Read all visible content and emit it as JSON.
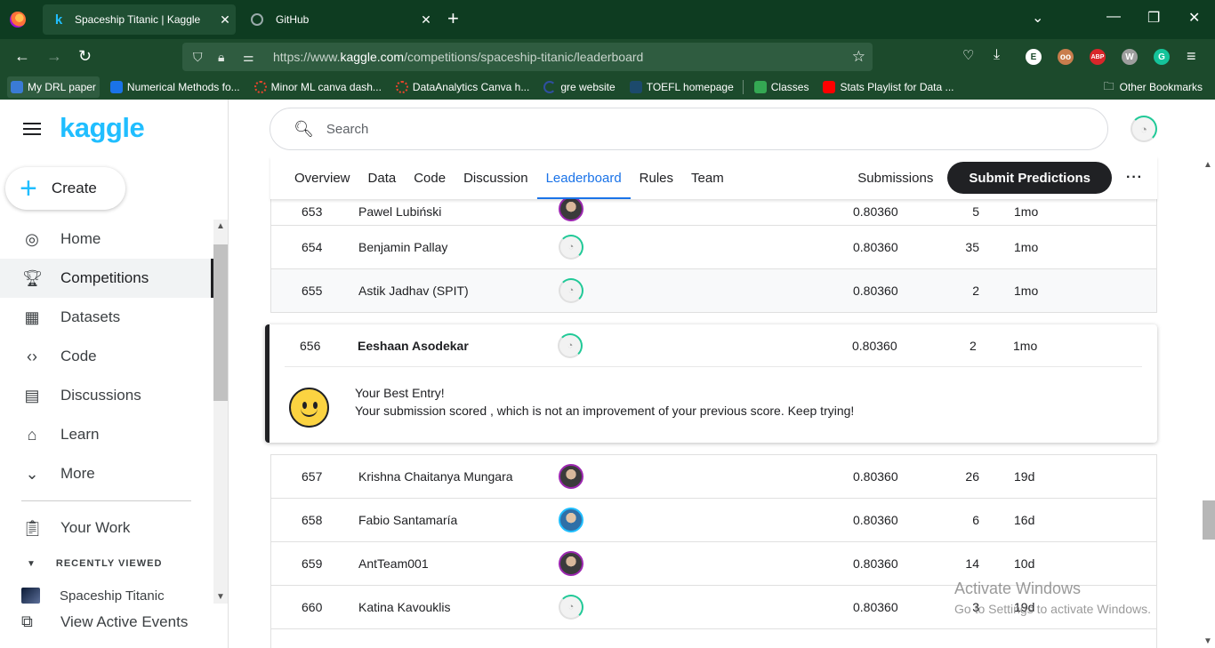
{
  "browser": {
    "tabs": [
      {
        "title": "Spaceship Titanic | Kaggle",
        "favicon": "k"
      },
      {
        "title": "GitHub"
      }
    ],
    "url_prefix": "https://www.",
    "url_domain": "kaggle.com",
    "url_path": "/competitions/spaceship-titanic/leaderboard",
    "bookmarks": [
      {
        "label": "My DRL paper",
        "color": "#3a7bd5"
      },
      {
        "label": "Numerical Methods fo...",
        "color": "#1a73e8"
      },
      {
        "label": "Minor ML canva dash...",
        "color": "#e8452c"
      },
      {
        "label": "DataAnalytics Canva h...",
        "color": "#e8452c"
      },
      {
        "label": "gre website",
        "color": "#2f4f9f"
      },
      {
        "label": "TOEFL homepage",
        "color": "#1c4a6c"
      },
      {
        "label": "Classes",
        "color": "#34a853"
      },
      {
        "label": "Stats Playlist for Data ...",
        "color": "#ff0000"
      }
    ],
    "other_bookmarks": "Other Bookmarks"
  },
  "sidebar": {
    "logo": "kaggle",
    "create": "Create",
    "items": [
      {
        "label": "Home",
        "icon": "compass-icon"
      },
      {
        "label": "Competitions",
        "icon": "trophy-icon"
      },
      {
        "label": "Datasets",
        "icon": "table-icon"
      },
      {
        "label": "Code",
        "icon": "code-icon"
      },
      {
        "label": "Discussions",
        "icon": "discussion-icon"
      },
      {
        "label": "Learn",
        "icon": "graduation-cap-icon"
      },
      {
        "label": "More",
        "icon": "chevron-down-icon"
      }
    ],
    "your_work": "Your Work",
    "recently_viewed": "RECENTLY VIEWED",
    "recent_item": "Spaceship Titanic",
    "view_active_events": "View Active Events"
  },
  "header": {
    "search_placeholder": "Search"
  },
  "tabs": {
    "items": [
      "Overview",
      "Data",
      "Code",
      "Discussion",
      "Leaderboard",
      "Rules",
      "Team"
    ],
    "submissions": "Submissions",
    "submit": "Submit Predictions",
    "more": "···"
  },
  "leaderboard": {
    "rows_top": [
      {
        "rank": "653",
        "name": "Pawel Lubiński",
        "score": "0.80360",
        "entries": "5",
        "last": "1mo",
        "avatar": "photo"
      },
      {
        "rank": "654",
        "name": "Benjamin Pallay",
        "score": "0.80360",
        "entries": "35",
        "last": "1mo",
        "avatar": "default"
      },
      {
        "rank": "655",
        "name": "Astik Jadhav (SPIT)",
        "score": "0.80360",
        "entries": "2",
        "last": "1mo",
        "avatar": "default"
      }
    ],
    "best": {
      "rank": "656",
      "name": "Eeshaan Asodekar",
      "score": "0.80360",
      "entries": "2",
      "last": "1mo",
      "title": "Your Best Entry!",
      "message": "Your submission scored , which is not an improvement of your previous score. Keep trying!"
    },
    "rows_bottom": [
      {
        "rank": "657",
        "name": "Krishna Chaitanya Mungara",
        "score": "0.80360",
        "entries": "26",
        "last": "19d",
        "avatar": "photo"
      },
      {
        "rank": "658",
        "name": "Fabio Santamaría",
        "score": "0.80360",
        "entries": "6",
        "last": "16d",
        "avatar": "photo2"
      },
      {
        "rank": "659",
        "name": "AntTeam001",
        "score": "0.80360",
        "entries": "14",
        "last": "10d",
        "avatar": "photo"
      },
      {
        "rank": "660",
        "name": "Katina Kavouklis",
        "score": "0.80360",
        "entries": "3",
        "last": "19d",
        "avatar": "default"
      }
    ]
  },
  "watermark": {
    "line1": "Activate Windows",
    "line2": "Go to Settings to activate Windows."
  }
}
